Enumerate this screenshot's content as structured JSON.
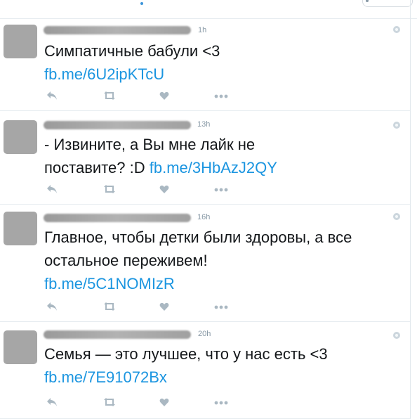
{
  "tweets": [
    {
      "time": "1h",
      "text": "Симпатичные бабули <3",
      "link": "fb.me/6U2ipKTcU"
    },
    {
      "time": "13h",
      "text": "- Извините, а Вы мне лайк не поставите? :D",
      "link": "fb.me/3HbAzJ2QY"
    },
    {
      "time": "16h",
      "text": "Главное, чтобы детки были здоровы, а все остальное переживем!",
      "link": "fb.me/5C1NOMIzR"
    },
    {
      "time": "20h",
      "text": "Семья — это лучшее, что у нас есть <3",
      "link": "fb.me/7E91072Bx"
    }
  ],
  "icons": {
    "reply": "reply-icon",
    "retweet": "retweet-icon",
    "like": "heart-icon",
    "more": "more-icon",
    "menu": "chevron-down-icon"
  },
  "colors": {
    "link": "#1b95e0",
    "text": "#14171a",
    "icon": "#aab8c2",
    "muted": "#8899a6"
  }
}
